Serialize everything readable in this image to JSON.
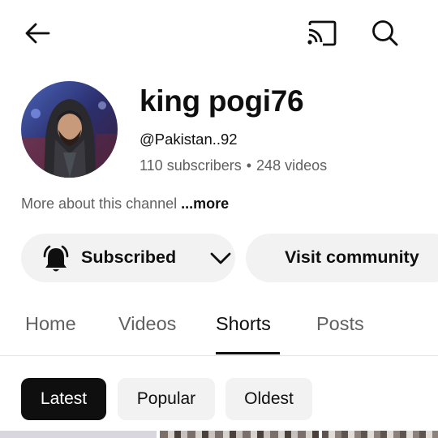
{
  "header": {
    "back_icon": "arrow-left-icon",
    "cast_icon": "cast-icon",
    "search_icon": "search-icon"
  },
  "channel": {
    "name": "king pogi76",
    "handle": "@Pakistan..92",
    "subscribers": "110 subscribers",
    "separator": "•",
    "videos": "248 videos",
    "about_text": "More about this channel",
    "about_more": "...more"
  },
  "actions": {
    "subscribe_label": "Subscribed",
    "community_label": "Visit community",
    "bell_icon": "bell-icon",
    "chevron_icon": "chevron-down-icon"
  },
  "tabs": [
    {
      "label": "Home",
      "active": false
    },
    {
      "label": "Videos",
      "active": false
    },
    {
      "label": "Shorts",
      "active": true
    },
    {
      "label": "Posts",
      "active": false
    }
  ],
  "filters": [
    {
      "label": "Latest",
      "selected": true
    },
    {
      "label": "Popular",
      "selected": false
    },
    {
      "label": "Oldest",
      "selected": false
    }
  ],
  "colors": {
    "text_primary": "#0f0f0f",
    "text_secondary": "#606060",
    "pill_bg": "#f2f2f2",
    "chip_selected_bg": "#0f0f0f"
  }
}
